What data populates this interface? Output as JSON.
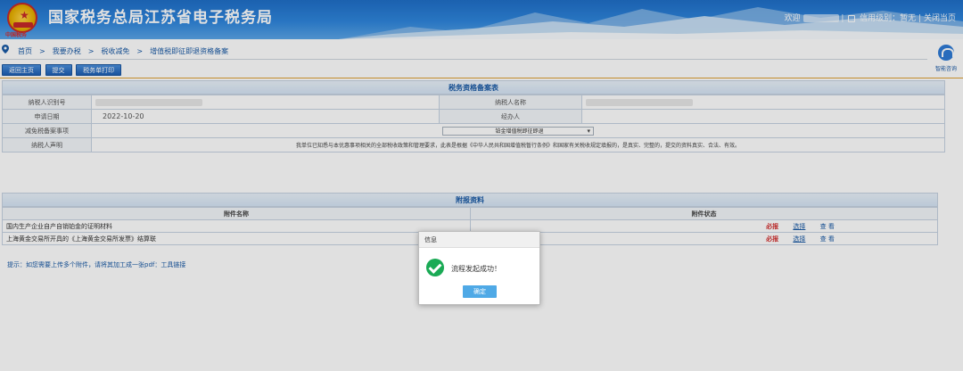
{
  "header": {
    "logo_text": "中国税务",
    "title": "国家税务总局江苏省电子税务局",
    "welcome": "欢迎 ",
    "credit_label": "信用级别：暂无",
    "close_label": "关闭当页",
    "separator": "|"
  },
  "breadcrumb": [
    "首页",
    "我要办税",
    "税收减免",
    "增值税即征即退资格备案"
  ],
  "breadcrumb_sep": ">",
  "helper": {
    "label": "智能咨询"
  },
  "toolbar": {
    "back": "返回主页",
    "submit": "提交",
    "print": "税务单打印"
  },
  "form": {
    "title": "税务资格备案表",
    "taxpayer_id_label": "纳税人识别号",
    "taxpayer_name_label": "纳税人名称",
    "apply_date_label": "申请日期",
    "apply_date": "2022-10-20",
    "handler_label": "经办人",
    "item_label": "减免税备案事项",
    "item_value": "铂金增值税即征即退",
    "declare_label": "纳税人声明",
    "declare_text": "我单位已知悉与本优惠事项相关的全部税收政策和管理要求，此表是根据《中华人民共和国增值税暂行条例》和国家有关税收规定填报的，是真实、完整的，提交的资料真实、合法、有效。"
  },
  "attachments": {
    "title": "附报资料",
    "col_name": "附件名称",
    "col_status": "附件状态",
    "rows": [
      {
        "name": "国内生产企业自产自销铂金的证明材料",
        "req": "必报",
        "choose": "选择",
        "view": "查 看"
      },
      {
        "name": "上海黄金交易所开具的《上海黄金交易所发票》结算联",
        "req": "必报",
        "choose": "选择",
        "view": "查 看"
      }
    ],
    "tip": "提示：如您需要上传多个附件，请将其加工成一张pdf：工具链接"
  },
  "dialog": {
    "title": "信息",
    "message": "流程发起成功！",
    "ok": "确定"
  }
}
